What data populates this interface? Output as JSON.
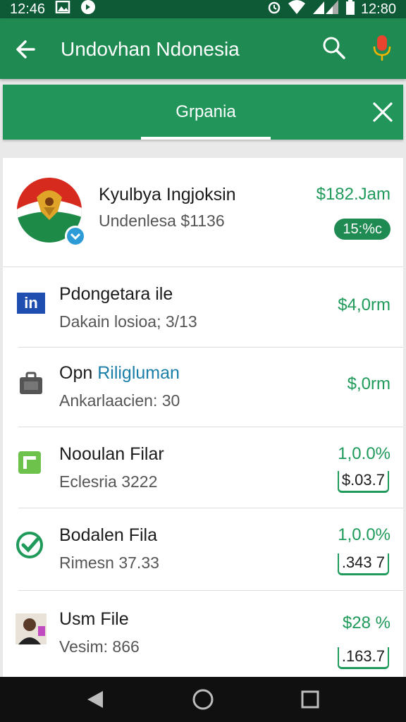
{
  "status_bar": {
    "time_left": "12:46",
    "time_right": "12:80"
  },
  "app_bar": {
    "title": "Undovhan Ndonesia"
  },
  "tabs": {
    "active_label": "Grpania"
  },
  "list": {
    "header": {
      "title": "Kyulbya Ingjoksin",
      "subtitle": "Undenlesa $1136",
      "amount": "$182.Jam",
      "badge": "15:%c"
    },
    "items": [
      {
        "title": "Pdongetara ile",
        "subtitle": "Dakain losioa; 3/13",
        "amount": "$4,0rm",
        "icon": "linkedin-icon"
      },
      {
        "title_a": "Opn",
        "title_b": "Riligluman",
        "subtitle": "Ankarlaacien: 30",
        "amount": "$,0rm",
        "icon": "briefcase-icon"
      },
      {
        "title": "Nooulan Filar",
        "subtitle": "Eclesria 3222",
        "amount": "1,0.0%",
        "amount2": "$.03.7",
        "icon": "sheet-icon"
      },
      {
        "title": "Bodalen Fila",
        "subtitle": "Rimesn 37.33",
        "amount": "1,0.0%",
        "amount2": ".343 7",
        "icon": "check-badge-icon"
      },
      {
        "title": "Usm File",
        "subtitle": "Vesim: 866",
        "amount": "$28 %",
        "amount2": ".163.7",
        "icon": "person-photo-icon"
      }
    ]
  },
  "colors": {
    "appbar": "#1f8a51",
    "accent": "#1f9a5a"
  }
}
